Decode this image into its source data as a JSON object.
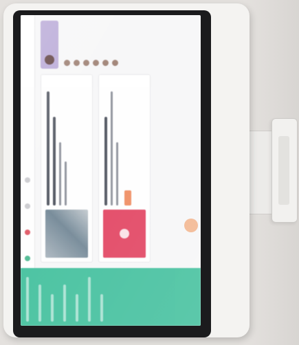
{
  "scene": {
    "description_free": true,
    "colors": {
      "wall": "#e4e1de",
      "housing": "#f4f3f1",
      "bezel": "#1b1b1d",
      "sidebar_accent": "#3fbf9c",
      "profile_accent": "#b7a6d6",
      "card_red": "#e2405f",
      "cta_orange": "#f08a5d"
    },
    "icons": [
      "avatar-icon",
      "notification-icon",
      "message-icon",
      "home-icon"
    ]
  }
}
